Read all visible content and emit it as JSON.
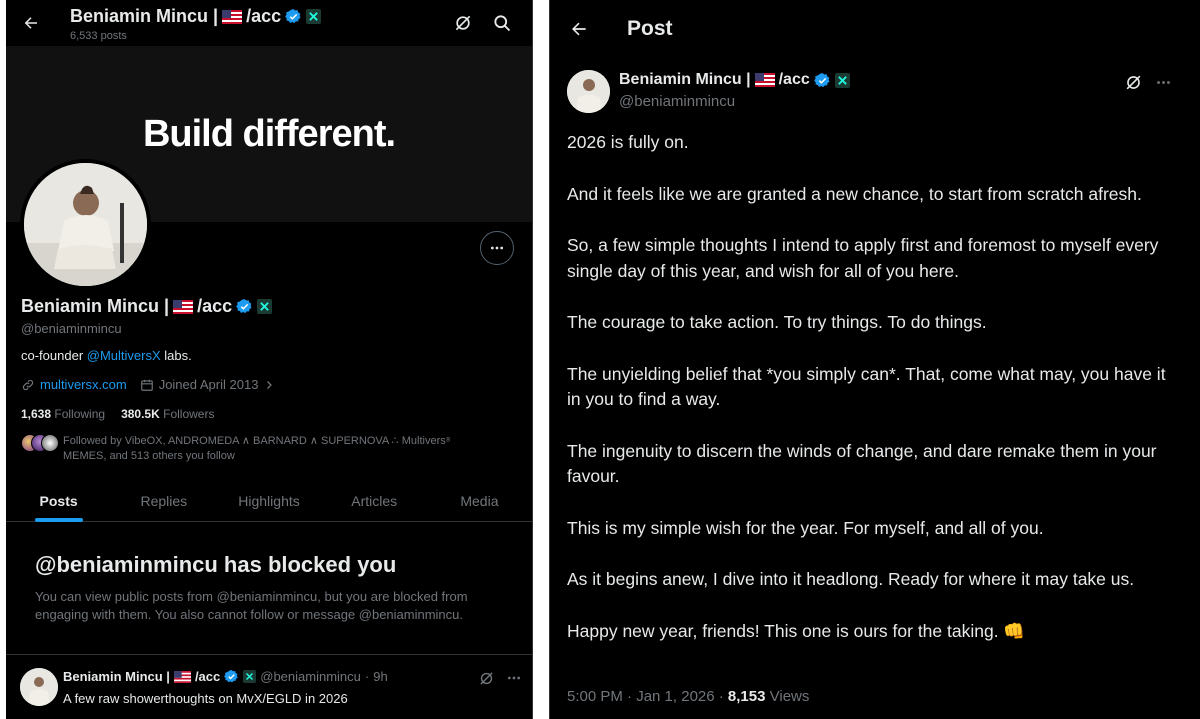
{
  "profile_panel": {
    "header": {
      "name": "Beniamin Mincu |",
      "name_suffix": "/acc",
      "posts_count": "6,533 posts"
    },
    "banner_text": "Build different.",
    "profile": {
      "name": "Beniamin Mincu |",
      "name_suffix": "/acc",
      "handle": "@beniaminmincu",
      "bio_prefix": "co-founder ",
      "bio_mention": "@MultiversX",
      "bio_suffix": " labs.",
      "website": "multiversx.com",
      "joined": "Joined April 2013",
      "following_count": "1,638",
      "following_label": "Following",
      "followers_count": "380.5K",
      "followers_label": "Followers",
      "followed_by": "Followed by VibeOX, ANDROMEDA ∧ BARNARD ∧ SUPERNOVA ∴ Multivers⁸ MEMES, and 513 others you follow"
    },
    "tabs": [
      {
        "label": "Posts",
        "active": true
      },
      {
        "label": "Replies",
        "active": false
      },
      {
        "label": "Highlights",
        "active": false
      },
      {
        "label": "Articles",
        "active": false
      },
      {
        "label": "Media",
        "active": false
      }
    ],
    "blocked": {
      "title": "@beniaminmincu has blocked you",
      "description": "You can view public posts from @beniaminmincu, but you are blocked from engaging with them. You also cannot follow or message @beniaminmincu."
    },
    "post_preview": {
      "name": "Beniamin Mincu |",
      "name_suffix": "/acc",
      "handle": "@beniaminmincu",
      "separator": "·",
      "time": "9h",
      "text": "A few raw showerthoughts on MvX/EGLD in 2026"
    }
  },
  "post_panel": {
    "title": "Post",
    "author_name": "Beniamin Mincu |",
    "author_name_suffix": "/acc",
    "author_handle": "@beniaminmincu",
    "paragraphs": [
      "2026 is fully on.",
      "And it feels like we are granted a new chance, to start from scratch afresh.",
      "So, a few simple thoughts I intend to apply first and foremost to myself every single day of this year, and wish for all of you here.",
      "The courage to take action. To try things. To do things.",
      "The unyielding belief that *you simply can*. That, come what may, you have it in you to find a way.",
      "The ingenuity to discern the winds of change, and dare remake them in your favour.",
      "This is my simple wish for the year. For myself, and all of you.",
      "As it begins anew, I dive into it headlong. Ready for where it may take us.",
      "Happy new year, friends! This one is ours for the taking. 👊"
    ],
    "timestamp": "5:00 PM · Jan 1, 2026 · ",
    "views_count": "8,153",
    "views_label": " Views"
  },
  "icons": {
    "back": "arrow-left-icon",
    "search": "search-icon",
    "grok": "grok-icon",
    "more": "more-horizontal-icon",
    "link": "link-icon",
    "calendar": "calendar-icon",
    "verified": "verified-badge-icon",
    "flag": "us-flag-icon",
    "affiliate": "multiversx-badge-icon"
  },
  "colors": {
    "background": "#000000",
    "text_primary": "#e7e9ea",
    "text_secondary": "#71767b",
    "accent": "#1d9bf0",
    "border": "#2f3336"
  }
}
